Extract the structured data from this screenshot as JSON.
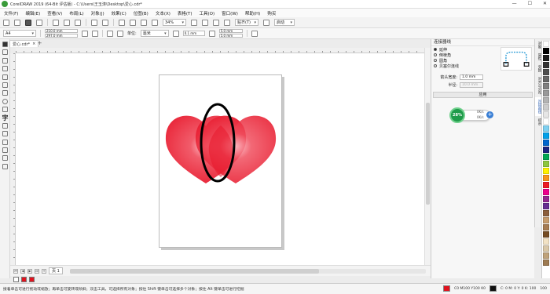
{
  "window": {
    "title": "CorelDRAW 2019 (64-Bit 评估版) - C:\\Users\\王玉涛\\Desktop\\爱心.cdr*",
    "min": "—",
    "max": "☐",
    "close": "✕"
  },
  "menu": [
    "文件(F)",
    "编辑(E)",
    "查看(V)",
    "布局(L)",
    "对象(J)",
    "效果(C)",
    "位图(B)",
    "文本(X)",
    "表格(T)",
    "工具(O)",
    "窗口(W)",
    "帮助(H)",
    "购买"
  ],
  "std": {
    "zoom": "34%",
    "snap": "贴齐(T)",
    "launch": "启动"
  },
  "prop": {
    "paper": "A4",
    "width": "210.0 mm",
    "height": "297.0 mm",
    "unit_label": "单位:",
    "unit": "毫米",
    "nudge": "0.1 mm",
    "dup_x": "5.0 mm",
    "dup_y": "5.0 mm"
  },
  "doc_tab": {
    "label": "爱心.cdr*",
    "close": "×",
    "add": "+"
  },
  "page_tab": {
    "label": "页 1",
    "nav_first": "⏮",
    "nav_prev": "◀",
    "nav_next": "▶",
    "nav_last": "⏭",
    "nav_add": "+"
  },
  "status": {
    "hint": "接着单击可进行拖动或缩放；再单击可旋转或倾斜；双击工具，可选择所有对象；按住 Shift 键单击可选择多个对象；按住 Alt 键单击可进行挖掘",
    "fill_label": "C0 M100 Y100 K0",
    "outline_label": "C: 0 M: 0 Y: 0 K: 100",
    "outline_width": "100"
  },
  "docker": {
    "title": "连接器线",
    "options": [
      {
        "label": "延伸",
        "checked": true
      },
      {
        "label": "倒棱角",
        "checked": false
      },
      {
        "label": "圆角",
        "checked": false
      },
      {
        "label": "贝塞尔连线",
        "checked": false
      }
    ],
    "arrow_label": "箭头宽度:",
    "arrow_value": "1.0 mm",
    "radius_label": "半径:",
    "radius_value": "10.0 mm",
    "apply": "应用"
  },
  "progress": {
    "percent": "28%",
    "up": "0K/s",
    "down": "0K/s",
    "plus": "+"
  },
  "sidetabs": [
    "对象",
    "属性",
    "变换",
    "对齐与分布",
    "连接器线",
    "提示"
  ],
  "colors": {
    "heart": "#e8182c",
    "fill_swatch": "#e0131f",
    "palette": [
      "#ffffff",
      "#000000",
      "#1a1a1a",
      "#333333",
      "#4d4d4d",
      "#666666",
      "#808080",
      "#999999",
      "#b3b3b3",
      "#cccccc",
      "#e6e6e6",
      "#ffffff",
      "#7fd0f0",
      "#00a0e9",
      "#0066cc",
      "#1a237e",
      "#00a651",
      "#8dc63f",
      "#fff200",
      "#f7941d",
      "#ed1c24",
      "#ec008c",
      "#92278f",
      "#662d91",
      "#8b5e3c",
      "#c69c6d",
      "#a67c52",
      "#754c24",
      "#f2e2c4",
      "#d9c7a7",
      "#bfa27a",
      "#9e7b52"
    ]
  }
}
